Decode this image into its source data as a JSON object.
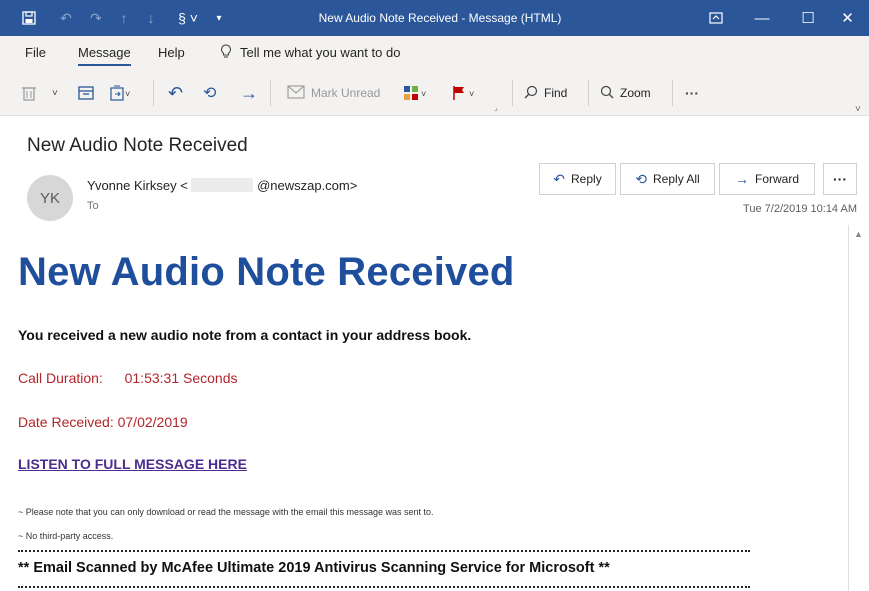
{
  "window": {
    "title": "New Audio Note Received - Message (HTML)",
    "accent_color": "#2b579a",
    "controls": {
      "restore_icon": "restore-ribbon-icon",
      "minimize": "—",
      "maximize": "☐",
      "close": "✕"
    }
  },
  "menu": {
    "items": [
      "File",
      "Message",
      "Help"
    ],
    "active": "Message",
    "tell_me": "Tell me what you want to do"
  },
  "ribbon": {
    "mark_unread": "Mark Unread",
    "find": "Find",
    "zoom": "Zoom",
    "more": "···"
  },
  "header": {
    "subject": "New Audio Note Received",
    "avatar_initials": "YK",
    "sender_name": "Yvonne Kirksey <",
    "sender_domain": "@newszap.com>",
    "to_label": "To",
    "date": "Tue 7/2/2019 10:14 AM",
    "reply": "Reply",
    "reply_all": "Reply All",
    "forward": "Forward",
    "more": "···"
  },
  "body": {
    "heading": "New Audio Note Received",
    "heading_color": "#1f4e9c",
    "intro": "You received a new audio note from a contact in your address book.",
    "call_duration_label": "Call Duration:",
    "call_duration_value": "01:53:31 Seconds",
    "date_received_label": "Date Received:",
    "date_received_value": "07/02/2019",
    "link": "LISTEN TO FULL MESSAGE HERE",
    "note1": "~ Please note that you can only download or read the message with the email this message was sent to.",
    "note2": "~ No third-party access.",
    "scan_notice": "** Email Scanned by McAfee Ultimate 2019 Antivirus Scanning Service for Microsoft **"
  }
}
